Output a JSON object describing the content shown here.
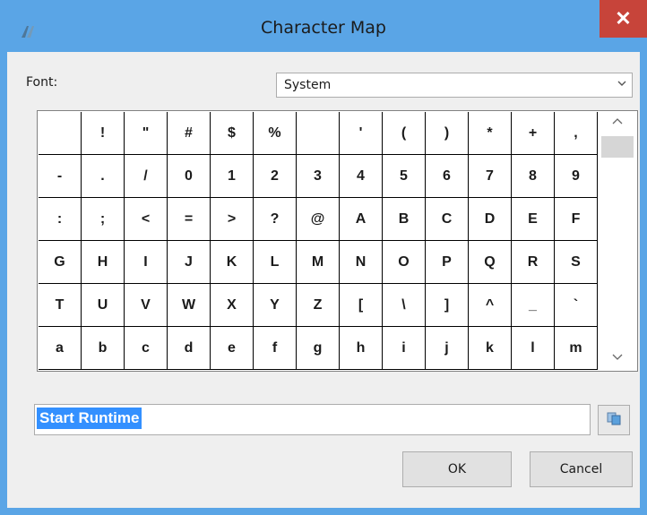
{
  "window": {
    "title": "Character Map"
  },
  "font": {
    "label": "Font:",
    "selected": "System"
  },
  "characters": [
    [
      "",
      "!",
      "\"",
      "#",
      "$",
      "%",
      "",
      "'",
      "(",
      ")",
      "*",
      "+",
      ","
    ],
    [
      "-",
      ".",
      "/",
      "0",
      "1",
      "2",
      "3",
      "4",
      "5",
      "6",
      "7",
      "8",
      "9"
    ],
    [
      ":",
      ";",
      "<",
      "=",
      ">",
      "?",
      "@",
      "A",
      "B",
      "C",
      "D",
      "E",
      "F"
    ],
    [
      "G",
      "H",
      "I",
      "J",
      "K",
      "L",
      "M",
      "N",
      "O",
      "P",
      "Q",
      "R",
      "S"
    ],
    [
      "T",
      "U",
      "V",
      "W",
      "X",
      "Y",
      "Z",
      "[",
      "\\",
      "]",
      "^",
      "_",
      "`"
    ],
    [
      "a",
      "b",
      "c",
      "d",
      "e",
      "f",
      "g",
      "h",
      "i",
      "j",
      "k",
      "l",
      "m"
    ]
  ],
  "copy_field": {
    "value": "Start Runtime"
  },
  "buttons": {
    "ok": "OK",
    "cancel": "Cancel"
  },
  "icons": {
    "app": "character-map-icon",
    "close": "close-icon",
    "dropdown": "chevron-down-icon",
    "scroll_up": "chevron-up-icon",
    "scroll_down": "chevron-down-icon",
    "copy": "copy-icon"
  },
  "colors": {
    "titlebar": "#5aa5e6",
    "close": "#c7443a",
    "selection": "#3390ff"
  }
}
